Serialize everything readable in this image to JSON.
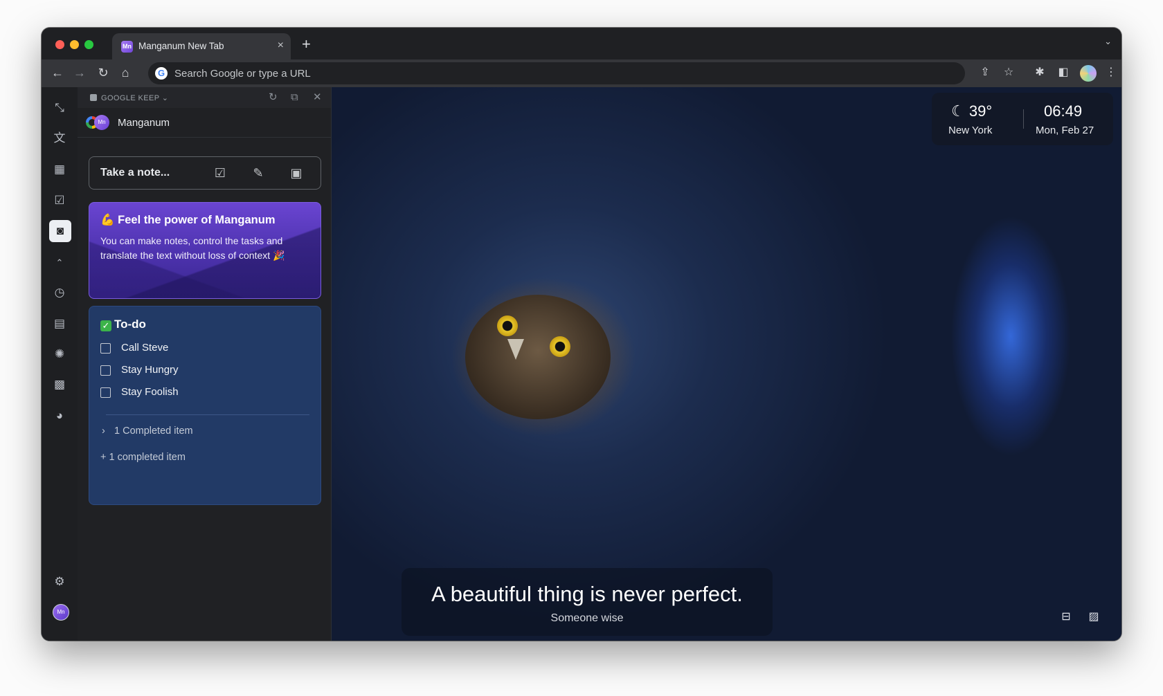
{
  "browser": {
    "tab": {
      "favicon": "Mn",
      "title": "Manganum New Tab",
      "close_icon": "×"
    },
    "new_tab_icon": "+",
    "tab_menu_icon": "⌄",
    "address_bar": {
      "placeholder": "Search Google or type a URL",
      "google_badge": "G"
    },
    "nav": {
      "back": "←",
      "forward": "→",
      "reload": "↻",
      "home": "⌂"
    },
    "toolbar_icons": {
      "share": "⇪",
      "bookmark": "☆",
      "extensions": "✱",
      "side_panel": "◧",
      "menu": "⋮"
    }
  },
  "rail": {
    "items": [
      {
        "name": "collapse",
        "glyph": "⤡"
      },
      {
        "name": "translate",
        "glyph": "文"
      },
      {
        "name": "calendar",
        "glyph": "▦"
      },
      {
        "name": "tasks",
        "glyph": "☑"
      },
      {
        "name": "keep",
        "glyph": "◙"
      },
      {
        "name": "chevron-up",
        "glyph": "⌃"
      },
      {
        "name": "history",
        "glyph": "◷"
      },
      {
        "name": "chat",
        "glyph": "▤"
      },
      {
        "name": "openai",
        "glyph": "✺"
      },
      {
        "name": "calculator",
        "glyph": "▩"
      },
      {
        "name": "pacman",
        "glyph": "◕"
      },
      {
        "name": "settings",
        "glyph": "⚙"
      }
    ],
    "avatar": "Mn"
  },
  "panel": {
    "header_label": "GOOGLE KEEP ⌄",
    "header_icons": {
      "refresh": "↻",
      "open_external": "⧉",
      "close": "✕"
    },
    "account_initials": "Mn",
    "account_name": "Manganum",
    "note_placeholder": "Take a note...",
    "note_icons": {
      "checkbox": "☑",
      "brush": "✎",
      "image": "▣"
    },
    "promo": {
      "emoji": "💪",
      "title": "Feel the power of Manganum",
      "body": "You can make notes, control the tasks and translate the text without loss of context 🎉"
    },
    "todo": {
      "emoji": "✓",
      "title": "To-do",
      "items": [
        "Call Steve",
        "Stay Hungry",
        "Stay Foolish"
      ],
      "completed_toggle": "1 Completed item",
      "completed_more": "+ 1 completed item"
    }
  },
  "widget": {
    "weather_icon": "☾",
    "temperature": "39°",
    "city": "New York",
    "time": "06:49",
    "date": "Mon, Feb 27"
  },
  "quote": {
    "text": "A beautiful thing is never perfect.",
    "author": "Someone wise"
  },
  "corner_icons": {
    "toggle": "⊟",
    "wallpaper": "▨"
  },
  "colors": {
    "accent_purple": "#6a45d1",
    "todo_blue": "#223a66",
    "chrome_dark": "#202124"
  }
}
